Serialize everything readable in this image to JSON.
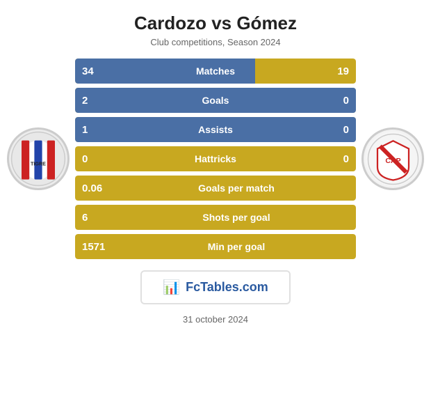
{
  "header": {
    "title": "Cardozo vs Gómez",
    "subtitle": "Club competitions, Season 2024"
  },
  "stats": {
    "rows": [
      {
        "label": "Matches",
        "left": "34",
        "right": "19",
        "fill_pct": 64,
        "has_right": true
      },
      {
        "label": "Goals",
        "left": "2",
        "right": "0",
        "fill_pct": 100,
        "has_right": true
      },
      {
        "label": "Assists",
        "left": "1",
        "right": "0",
        "fill_pct": 100,
        "has_right": true
      },
      {
        "label": "Hattricks",
        "left": "0",
        "right": "0",
        "fill_pct": 0,
        "has_right": true
      }
    ],
    "single_rows": [
      {
        "label": "Goals per match",
        "left": "0.06"
      },
      {
        "label": "Shots per goal",
        "left": "6"
      },
      {
        "label": "Min per goal",
        "left": "1571"
      }
    ]
  },
  "banner": {
    "text": "FcTables.com"
  },
  "footer": {
    "date": "31 october 2024"
  }
}
